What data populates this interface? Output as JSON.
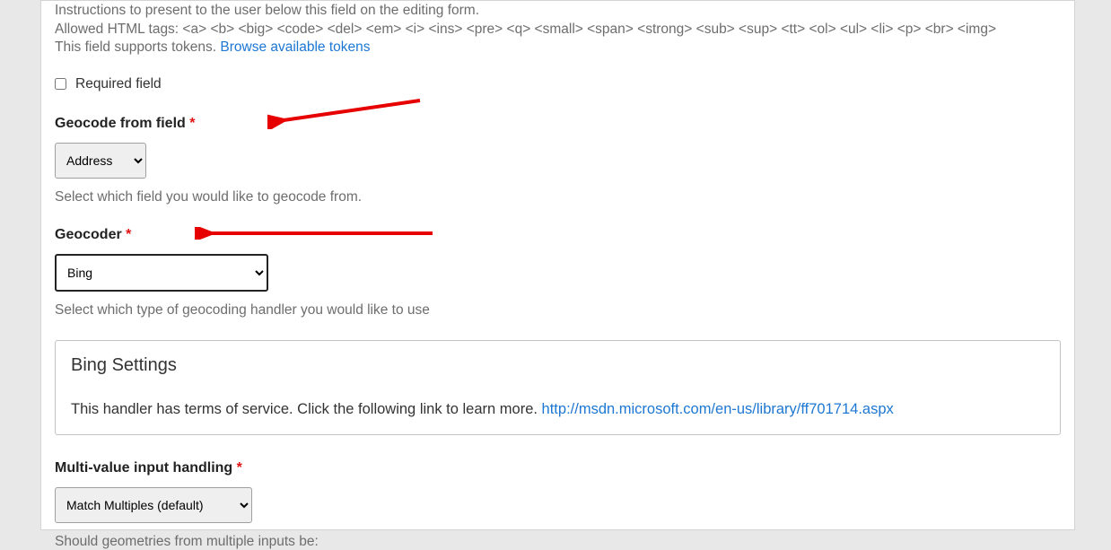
{
  "instructions": {
    "line1": "Instructions to present to the user below this field on the editing form.",
    "line2": "Allowed HTML tags: <a> <b> <big> <code> <del> <em> <i> <ins> <pre> <q> <small> <span> <strong> <sub> <sup> <tt> <ol> <ul> <li> <p> <br> <img>",
    "line3_prefix": "This field supports tokens. ",
    "line3_link": "Browse available tokens"
  },
  "required": {
    "label": "Required field"
  },
  "geocode_from": {
    "label": "Geocode from field ",
    "selected": "Address",
    "desc": "Select which field you would like to geocode from."
  },
  "geocoder": {
    "label": "Geocoder ",
    "selected": "Bing",
    "desc": "Select which type of geocoding handler you would like to use"
  },
  "bing_settings": {
    "title": "Bing Settings",
    "text_prefix": "This handler has terms of service. Click the following link to learn more. ",
    "link": "http://msdn.microsoft.com/en-us/library/ff701714.aspx"
  },
  "multi_value": {
    "label": "Multi-value input handling ",
    "selected": "Match Multiples (default)",
    "desc": "Should geometries from multiple inputs be:"
  }
}
